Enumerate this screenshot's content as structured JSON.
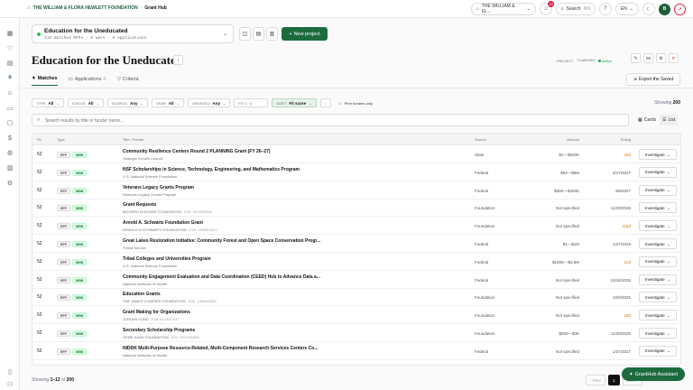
{
  "topbar": {
    "org": "THE WILLIAM & FLORA HEWLETT FOUNDATION",
    "separator": "›",
    "page": "Grant Hub",
    "org_switch": "THE WILLIAM & FL...",
    "notifications": "10",
    "search": "Search",
    "search_kbd": "⌘K",
    "language": "EN",
    "avatar": "B",
    "colors": {
      "brand": "#1c6b3f",
      "alert": "#e11d48"
    }
  },
  "project_selector": {
    "name": "Education for the Uneducated",
    "meta": "215 matched RFPs · 0 wars · 0 Applications"
  },
  "new_project": "New project",
  "page_title": "Education for the Uneducated",
  "project_meta": {
    "label": "PROJECT",
    "id": "fcab5268",
    "status": "Active"
  },
  "tabs": [
    {
      "label": "Matches",
      "count": ""
    },
    {
      "label": "Applications",
      "count": "0"
    },
    {
      "label": "Criteria",
      "count": ""
    }
  ],
  "export_label": "Export the Saved",
  "filters": [
    {
      "label": "TYPE",
      "value": "All"
    },
    {
      "label": "STATUS",
      "value": "All"
    },
    {
      "label": "SOURCE",
      "value": "Any"
    },
    {
      "label": "YEAR",
      "value": "All"
    },
    {
      "label": "GRANTED",
      "value": "Any"
    },
    {
      "label": "FIT ≥",
      "value": "0"
    },
    {
      "label": "SORT",
      "value": "Fit score"
    }
  ],
  "peer_funders": "Peer funders only",
  "showing": {
    "label": "Showing",
    "count": "200"
  },
  "search": {
    "placeholder": "Search results by title or funder name..."
  },
  "view_toggle": {
    "cards": "Cards",
    "list": "List"
  },
  "table": {
    "headers": {
      "fit": "Fit",
      "type": "Type",
      "title": "Title / Funder",
      "source": "Source",
      "amount": "Amount",
      "timing": "Timing"
    },
    "action_label": "Investigate",
    "rows": [
      {
        "fit": "52",
        "type": "RFP",
        "status": "NEW",
        "title": "Community Resilience Centers Round 2 PLANNING Grant (FY 26–27)",
        "funder": "Strategic Growth Council",
        "ein": "",
        "source": "State",
        "amount": "$1—$500K",
        "timing": "29d",
        "warn": true
      },
      {
        "fit": "52",
        "type": "RFP",
        "status": "NEW",
        "title": "NSF Scholarships in Science, Technology, Engineering, and Mathematics Program",
        "funder": "U.S. National Science Foundation",
        "ein": "",
        "source": "Federal",
        "amount": "$94—$9M",
        "timing": "3/17/2027",
        "warn": false
      },
      {
        "fit": "52",
        "type": "RFP",
        "status": "NEW",
        "title": "Veterans Legacy Grants Program",
        "funder": "Veterans Legacy Grants Program",
        "ein": "",
        "source": "Federal",
        "amount": "$50K—$400K",
        "timing": "4/8/2027",
        "warn": false
      },
      {
        "fit": "52",
        "type": "RFP",
        "status": "NEW",
        "title": "Grant Requests",
        "funder": "MILDRED M MCKEE FOUNDATION",
        "ein": "EIN 264436394",
        "source": "Foundation",
        "amount": "Not specified",
        "timing": "11/30/2026",
        "warn": false
      },
      {
        "fit": "52",
        "type": "RFP",
        "status": "NEW",
        "title": "Arnold A. Schwartz Foundation Grant",
        "funder": "ARNOLD A SCHWARTZ FOUNDATION",
        "ein": "EIN 236853251",
        "source": "Foundation",
        "amount": "Not specified",
        "timing": "116d",
        "warn": true
      },
      {
        "fit": "52",
        "type": "RFP",
        "status": "NEW",
        "title": "Great Lakes Restoration Initiative: Community Forest and Open Space Conservation Progr...",
        "funder": "Forest Service",
        "ein": "",
        "source": "Federal",
        "amount": "$1—$1M",
        "timing": "12/7/2026",
        "warn": false
      },
      {
        "fit": "52",
        "type": "RFP",
        "status": "NEW",
        "title": "Tribal Colleges and Universities Program",
        "funder": "U.S. National Science Foundation",
        "ein": "",
        "source": "Federal",
        "amount": "$100K—$3.5M",
        "timing": "21d",
        "warn": true
      },
      {
        "fit": "52",
        "type": "RFP",
        "status": "NEW",
        "title": "Community Engagement Evaluation and Data Coordination (CEED) Hub to Advance Data a...",
        "funder": "National Institutes of Health",
        "ein": "",
        "source": "Federal",
        "amount": "Not specified",
        "timing": "10/16/2026",
        "warn": false
      },
      {
        "fit": "52",
        "type": "RFP",
        "status": "NEW",
        "title": "Education Grants",
        "funder": "THE JAMES H NAPIER FOUNDATION",
        "ein": "EIN 136829983",
        "source": "Foundation",
        "amount": "Not specified",
        "timing": "10/9/2026",
        "warn": false
      },
      {
        "fit": "52",
        "type": "RFP",
        "status": "NEW",
        "title": "Grant Making for Organizations",
        "funder": "JORDAN FUND",
        "ein": "EIN 611637527",
        "source": "Foundation",
        "amount": "Not specified",
        "timing": "29d",
        "warn": true
      },
      {
        "fit": "52",
        "type": "RFP",
        "status": "NEW",
        "title": "Secondary Scholarship Programs",
        "funder": "GENE HAAS FOUNDATION",
        "ein": "EIN 954756835",
        "source": "Foundation",
        "amount": "$500—$3K",
        "timing": "11/30/2026",
        "warn": false
      },
      {
        "fit": "52",
        "type": "RFP",
        "status": "NEW",
        "title": "NIDDK Multi-Purpose Resource-Related, Multi-Component Research Services Centers Co...",
        "funder": "National Institutes of Health",
        "ein": "",
        "source": "Federal",
        "amount": "Not specified",
        "timing": "1/27/2027",
        "warn": false
      }
    ]
  },
  "footer": {
    "prefix": "Showing",
    "range": "1–12",
    "of": "of",
    "total": "200"
  },
  "pager": {
    "prev": "‹ Prev",
    "page": "1",
    "next": "Next ›"
  },
  "assistant": "GrantHub Assistant"
}
